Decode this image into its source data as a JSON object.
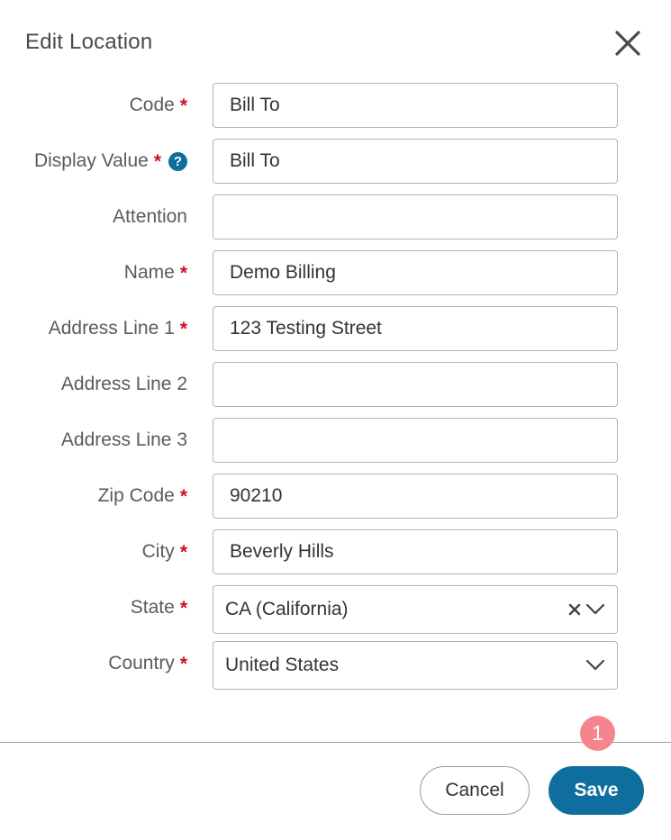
{
  "dialog": {
    "title": "Edit Location",
    "close_icon": "close-icon"
  },
  "fields": [
    {
      "label": "Code",
      "required": true,
      "value": "Bill To"
    },
    {
      "label": "Display Value",
      "required": true,
      "help": true,
      "value": "Bill To"
    },
    {
      "label": "Attention",
      "required": false,
      "value": ""
    },
    {
      "label": "Name",
      "required": true,
      "value": "Demo Billing"
    },
    {
      "label": "Address Line 1",
      "required": true,
      "value": "123 Testing Street"
    },
    {
      "label": "Address Line 2",
      "required": false,
      "value": ""
    },
    {
      "label": "Address Line 3",
      "required": false,
      "value": ""
    },
    {
      "label": "Zip Code",
      "required": true,
      "value": "90210"
    },
    {
      "label": "City",
      "required": true,
      "value": "Beverly Hills"
    }
  ],
  "state": {
    "label": "State",
    "required": true,
    "value": "CA (California)"
  },
  "country": {
    "label": "Country",
    "required": true,
    "value": "United States"
  },
  "required_marker": "*",
  "help_glyph": "?",
  "footer": {
    "cancel_label": "Cancel",
    "save_label": "Save",
    "step_badge": "1"
  },
  "colors": {
    "accent": "#0e6e9e",
    "required": "#c8102e",
    "badge": "#f5848c"
  }
}
